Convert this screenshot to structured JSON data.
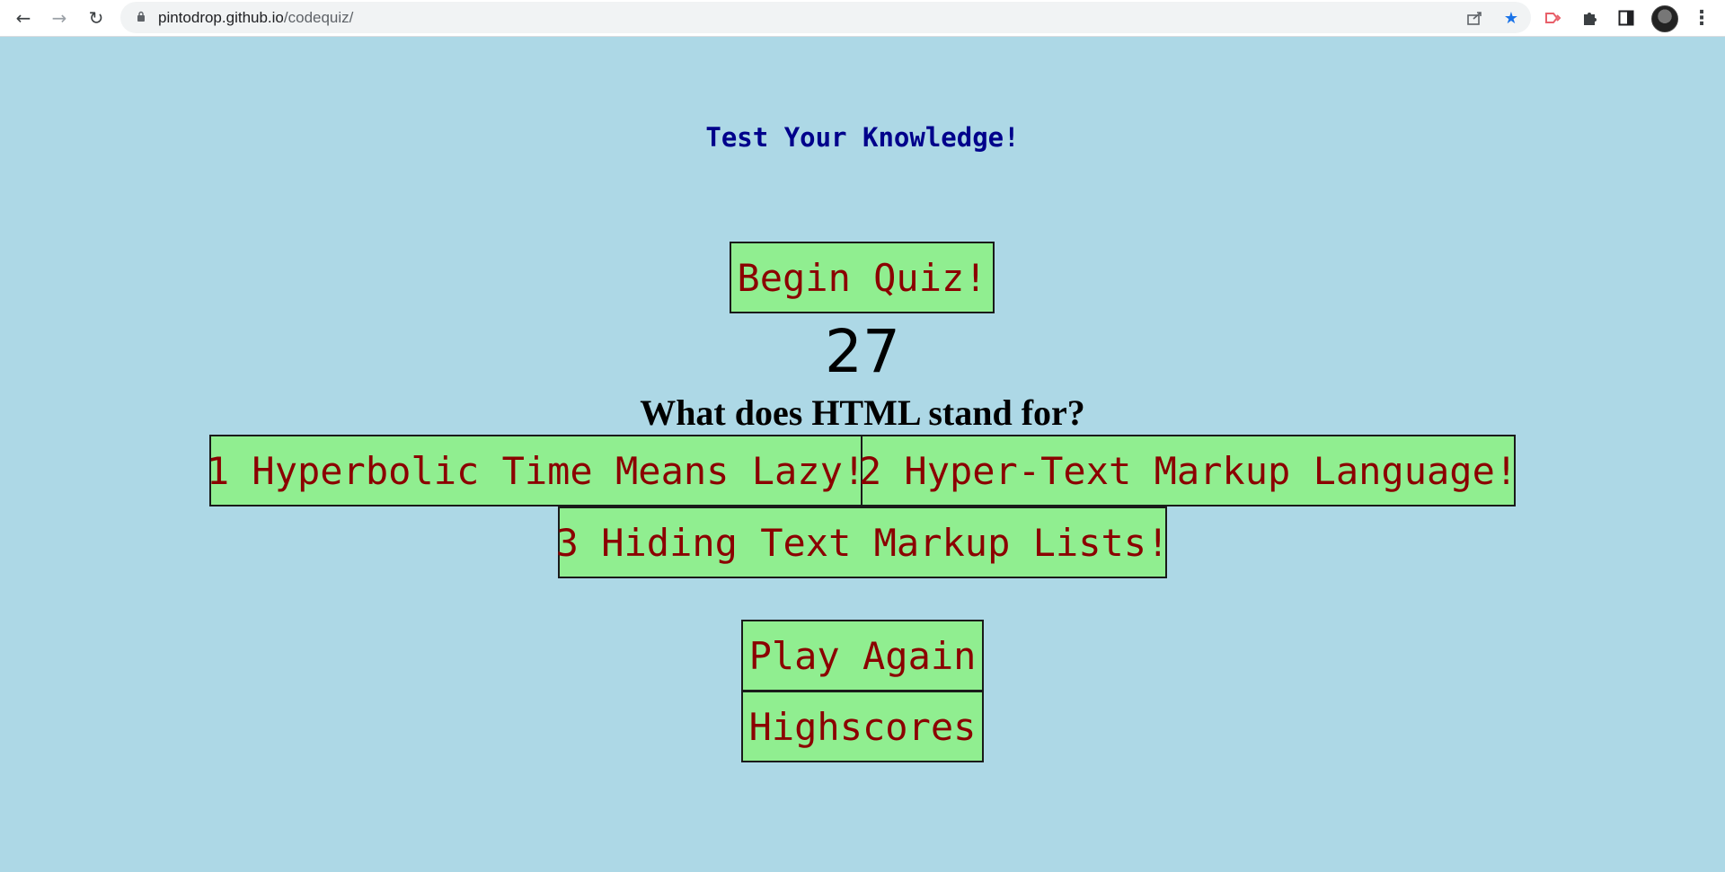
{
  "browser": {
    "url_host": "pintodrop.github.io",
    "url_path": "/codequiz/",
    "icons": {
      "back": "back-arrow-icon",
      "forward": "forward-arrow-icon",
      "reload": "reload-icon",
      "lock": "lock-icon",
      "share": "share-icon",
      "bookmark": "star-icon",
      "extension_a": "extension-icon",
      "extensions": "puzzle-icon",
      "side_panel": "side-panel-icon",
      "menu": "kebab-menu-icon"
    },
    "colors": {
      "bookmark_star": "#1a73e8",
      "extension_a": "#e8606a"
    }
  },
  "page": {
    "title": "Test Your Knowledge!",
    "begin_label": "Begin Quiz!",
    "timer": "27",
    "question": "What does HTML stand for?",
    "answers": [
      "1 Hyperbolic Time Means Lazy!",
      "2 Hyper-Text Markup Language!",
      "3 Hiding Text Markup Lists!"
    ],
    "play_again_label": "Play Again",
    "highscores_label": "Highscores",
    "colors": {
      "background": "#add8e6",
      "button_bg": "#90ee90",
      "button_text": "#8b0000",
      "title_text": "#00008b"
    }
  }
}
